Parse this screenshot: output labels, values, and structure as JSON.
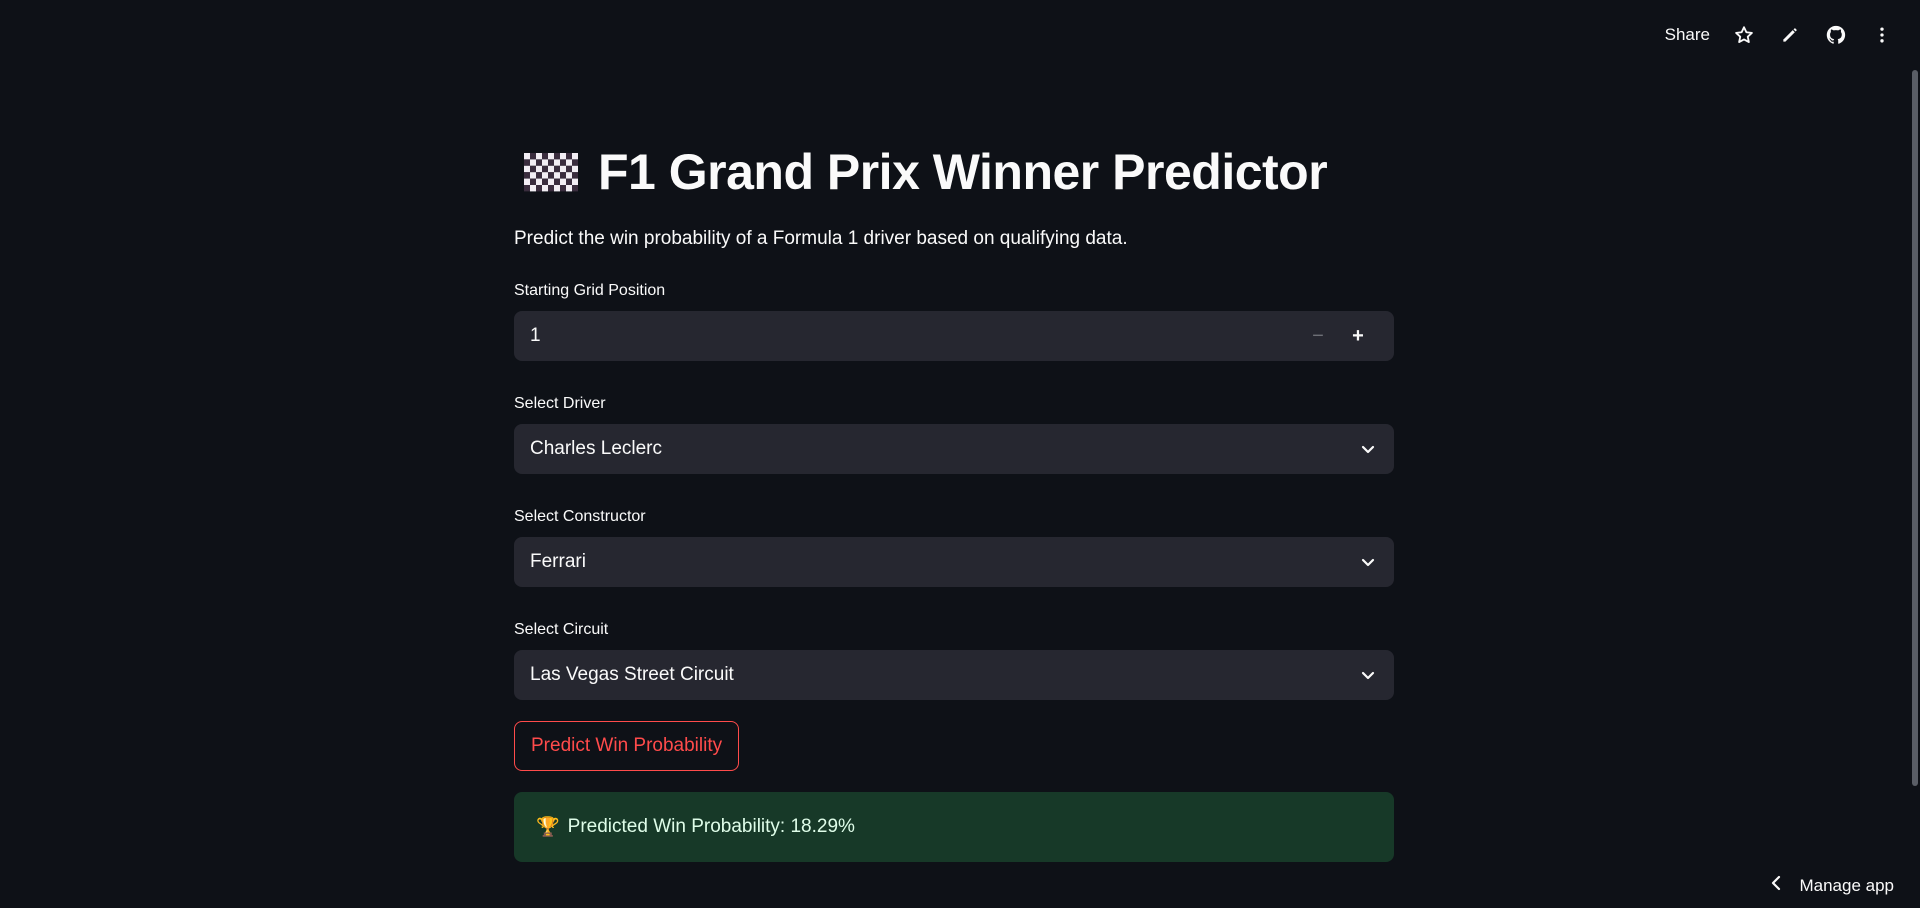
{
  "toolbar": {
    "share_label": "Share",
    "icons": [
      "star-icon",
      "pencil-icon",
      "github-icon",
      "more-vertical-icon"
    ]
  },
  "header": {
    "emoji_icon": "checkered-flag-icon",
    "title": "F1 Grand Prix Winner Predictor",
    "subtitle": "Predict the win probability of a Formula 1 driver based on qualifying data."
  },
  "form": {
    "grid_position": {
      "label": "Starting Grid Position",
      "value": "1"
    },
    "driver": {
      "label": "Select Driver",
      "value": "Charles Leclerc"
    },
    "constructor": {
      "label": "Select Constructor",
      "value": "Ferrari"
    },
    "circuit": {
      "label": "Select Circuit",
      "value": "Las Vegas Street Circuit"
    },
    "predict_label": "Predict Win Probability"
  },
  "result": {
    "icon": "trophy-icon",
    "text": "Predicted Win Probability: 18.29%"
  },
  "footer": {
    "manage_label": "Manage app"
  },
  "colors": {
    "background": "#0e1117",
    "input_bg": "#262730",
    "accent": "#ff4b4b",
    "success_bg": "#173928",
    "success_text": "#dffde9"
  }
}
